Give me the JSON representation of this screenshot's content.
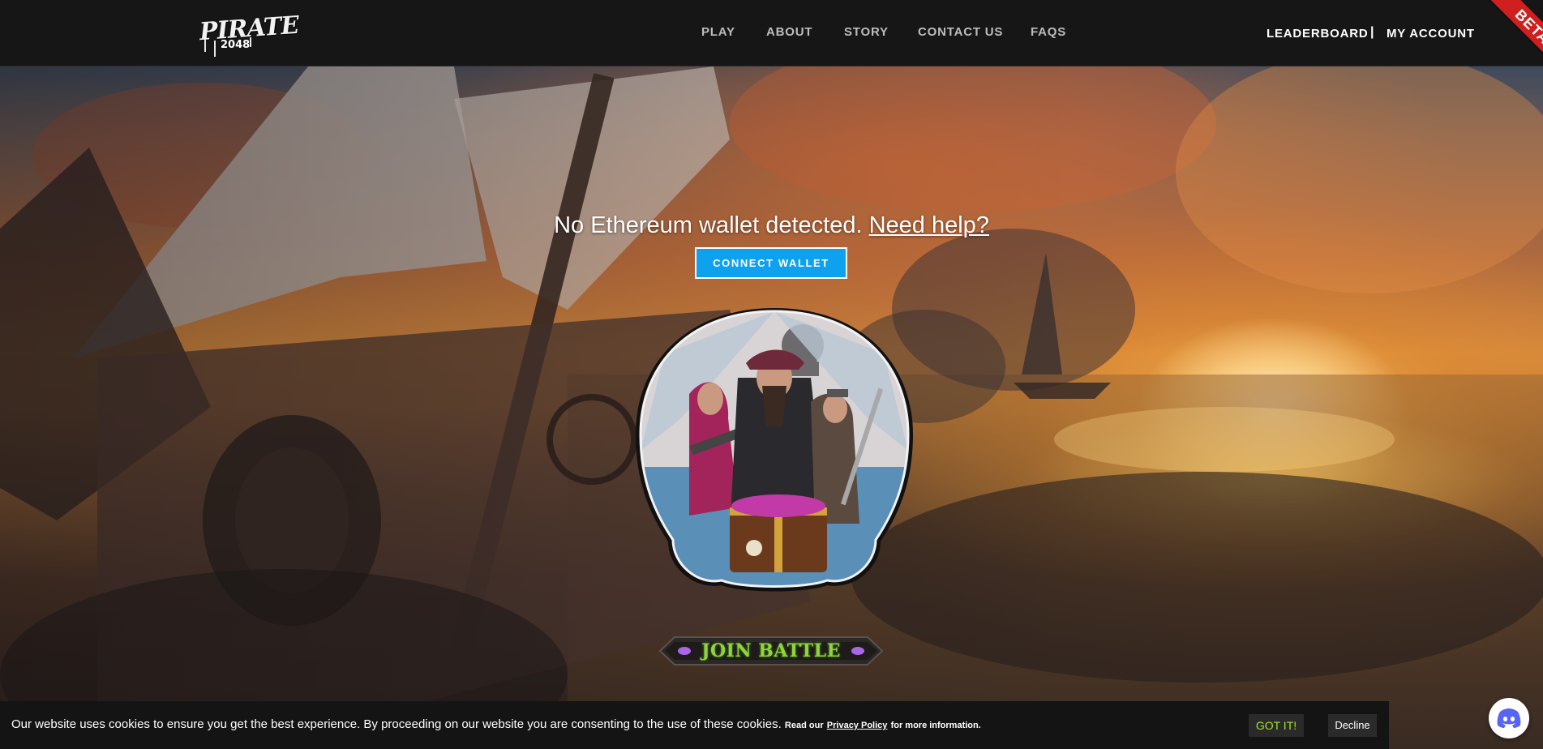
{
  "header": {
    "logo_text_top": "PIRATE",
    "logo_text_bottom": "2048",
    "nav": [
      {
        "label": "PLAY"
      },
      {
        "label": "ABOUT"
      },
      {
        "label": "STORY"
      },
      {
        "label": "CONTACT US"
      },
      {
        "label": "FAQS"
      }
    ],
    "leaderboard_label": "LEADERBOARD",
    "separator": "|",
    "account_label": "MY ACCOUNT",
    "beta_label": "BETA"
  },
  "hero": {
    "wallet_message": "No Ethereum wallet detected.",
    "help_link": "Need help?",
    "connect_button": "CONNECT WALLET",
    "join_button": "JOIN BATTLE"
  },
  "cookie": {
    "message": "Our website uses cookies to ensure you get the best experience. By proceeding on our website you are consenting to the use of these cookies.",
    "read_our": "Read our",
    "privacy_link": "Privacy Policy",
    "more_info": "for more information.",
    "accept_label": "GOT IT!",
    "decline_label": "Decline"
  },
  "colors": {
    "header_bg": "#161616",
    "connect_button": "#0ea1ee",
    "beta_ribbon": "#d01f1f",
    "accept_text": "#a6e22e",
    "join_text": "#8fd43a"
  },
  "icons": {
    "chat_widget": "discord-icon"
  }
}
